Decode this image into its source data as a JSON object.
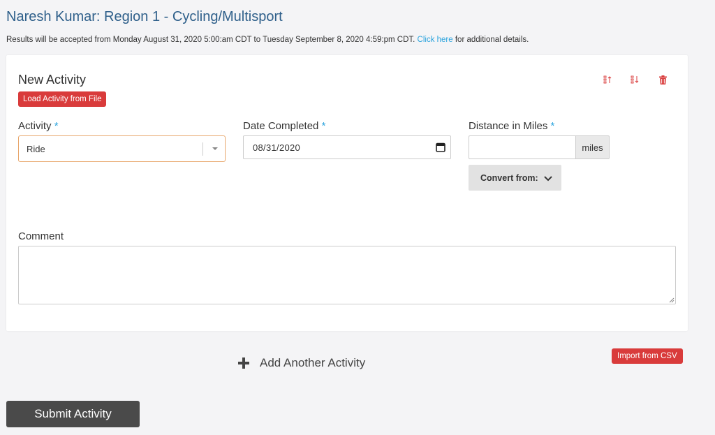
{
  "header": {
    "title": "Naresh Kumar: Region 1 - Cycling/Multisport",
    "notice_prefix": "Results will be accepted from Monday August 31, 2020 5:00:am CDT to Tuesday September 8, 2020 4:59:pm CDT. ",
    "notice_link": "Click here",
    "notice_suffix": " for additional details."
  },
  "activity_card": {
    "title": "New Activity",
    "load_button": "Load Activity from File",
    "activity_label": "Activity",
    "activity_value": "Ride",
    "date_label": "Date Completed",
    "date_value": "08/31/2020",
    "distance_label": "Distance in Miles",
    "distance_value": "",
    "distance_unit": "miles",
    "convert_label": "Convert from:",
    "comment_label": "Comment",
    "comment_value": "",
    "required_mark": "*"
  },
  "actions": {
    "add_activity": "Add Another Activity",
    "import_csv": "Import from CSV",
    "submit": "Submit Activity"
  },
  "icons": {
    "move_up": "sort-up-icon",
    "move_down": "sort-down-icon",
    "delete": "trash-icon",
    "dropdown": "caret-down-icon",
    "calendar": "calendar-icon",
    "convert": "chevron-down-icon",
    "add": "plus-icon"
  },
  "colors": {
    "title": "#2e5f8a",
    "link": "#2aa3dd",
    "danger": "#d93b3b",
    "focus_border": "#e8a76c",
    "submit_bg": "#4a4a4a"
  }
}
